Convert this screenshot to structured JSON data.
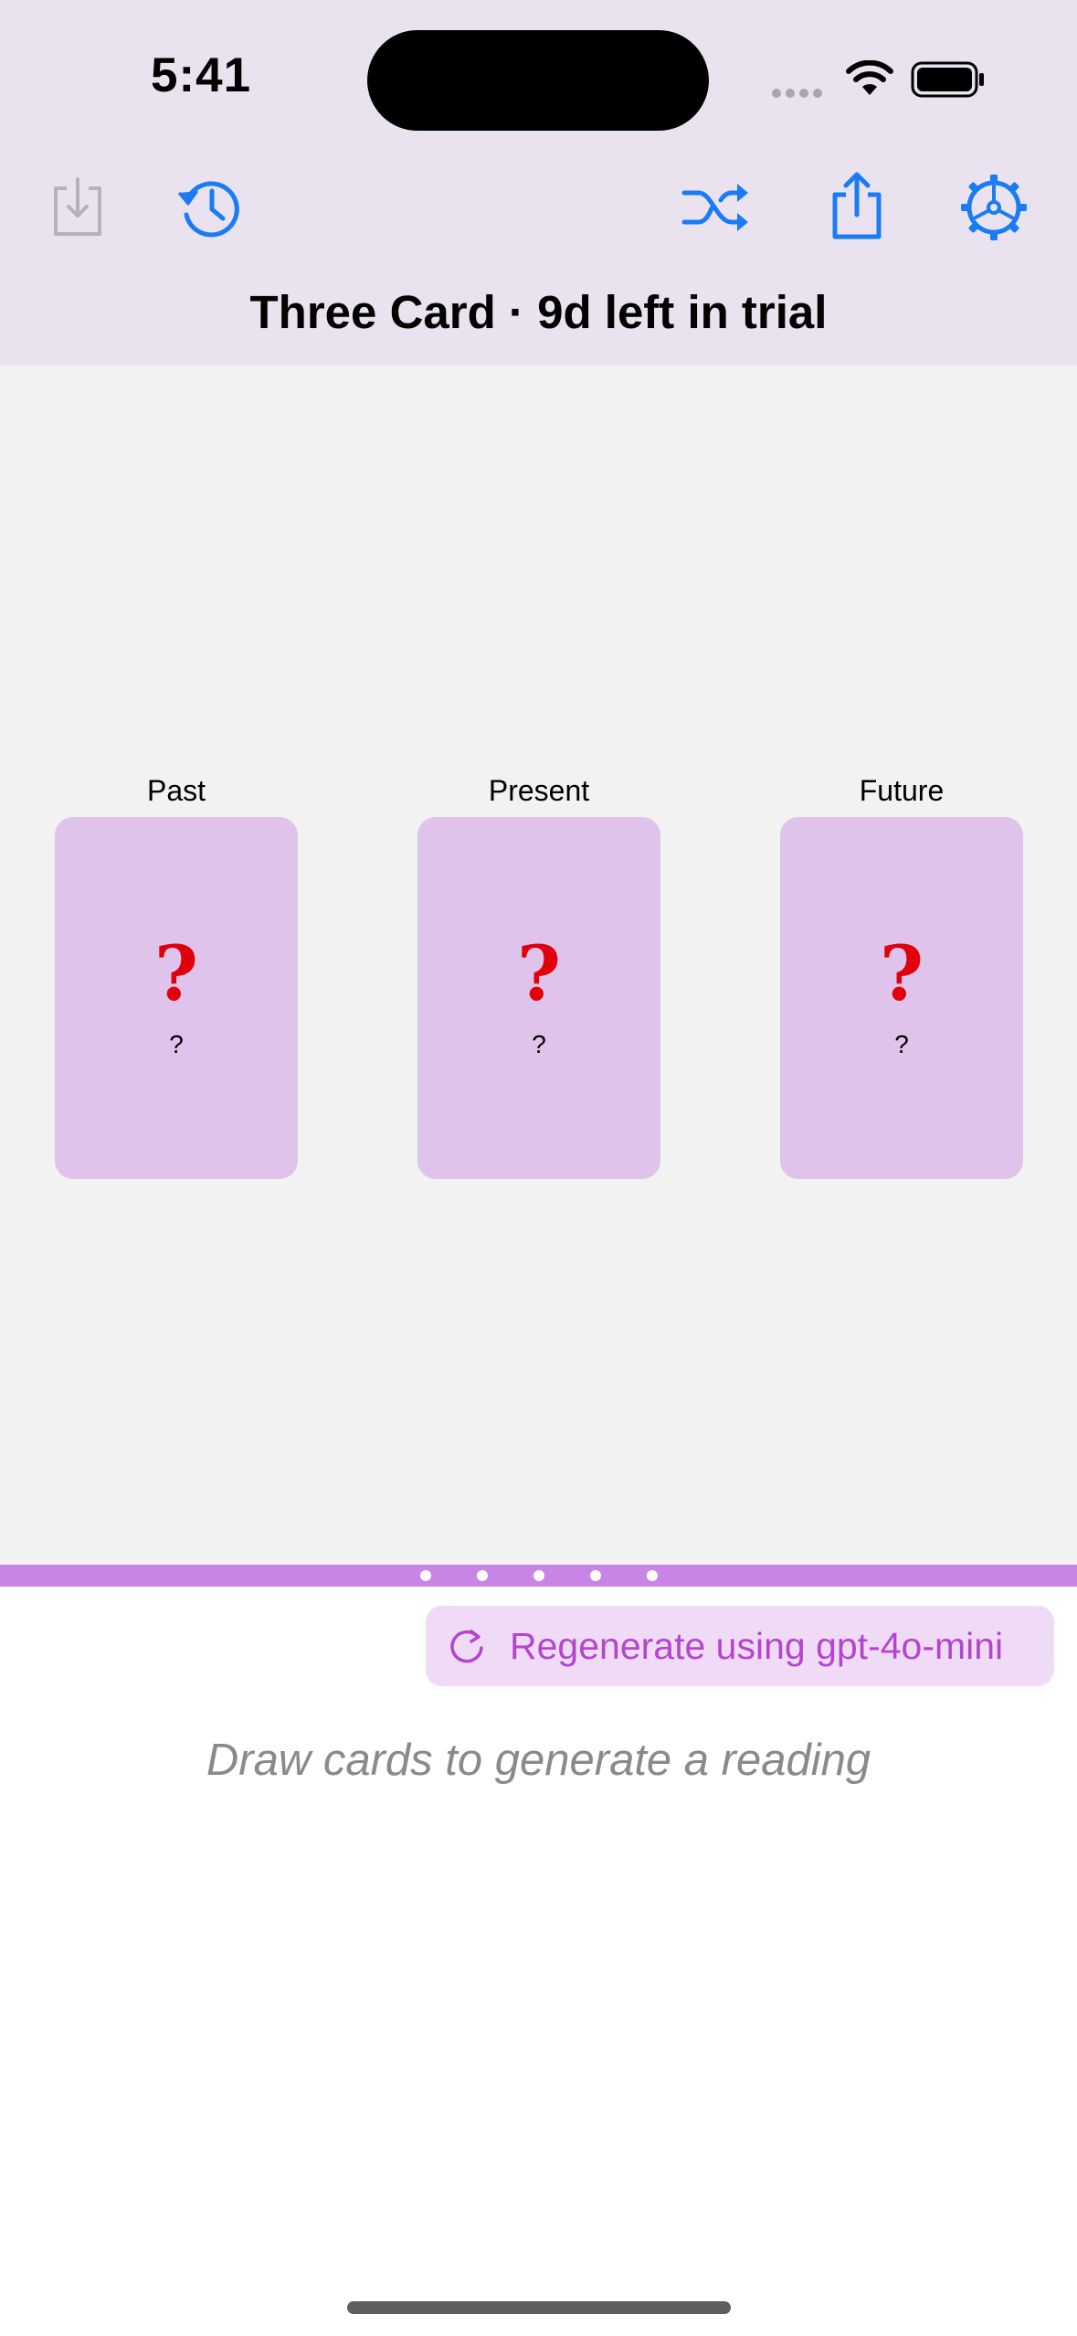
{
  "status_bar": {
    "time": "5:41"
  },
  "toolbar": {
    "save_icon": "tray-arrow-down-icon",
    "history_icon": "clock-history-icon",
    "shuffle_icon": "shuffle-icon",
    "share_icon": "share-icon",
    "settings_icon": "gear-icon"
  },
  "header": {
    "title": "Three Card · 9d left in trial"
  },
  "cards": [
    {
      "label": "Past",
      "symbol": "?",
      "name": "?"
    },
    {
      "label": "Present",
      "symbol": "?",
      "name": "?"
    },
    {
      "label": "Future",
      "symbol": "?",
      "name": "?"
    }
  ],
  "regenerate": {
    "label": "Regenerate using gpt-4o-mini",
    "icon": "refresh-icon"
  },
  "reading": {
    "placeholder": "Draw cards to generate a reading"
  },
  "colors": {
    "accent": "#1A7CF5",
    "header_bg": "#EAE2EF",
    "card_bg": "#DFC3EA",
    "question_mark": "#E0000C",
    "divider": "#C985E6",
    "regen_text": "#B545CF"
  }
}
